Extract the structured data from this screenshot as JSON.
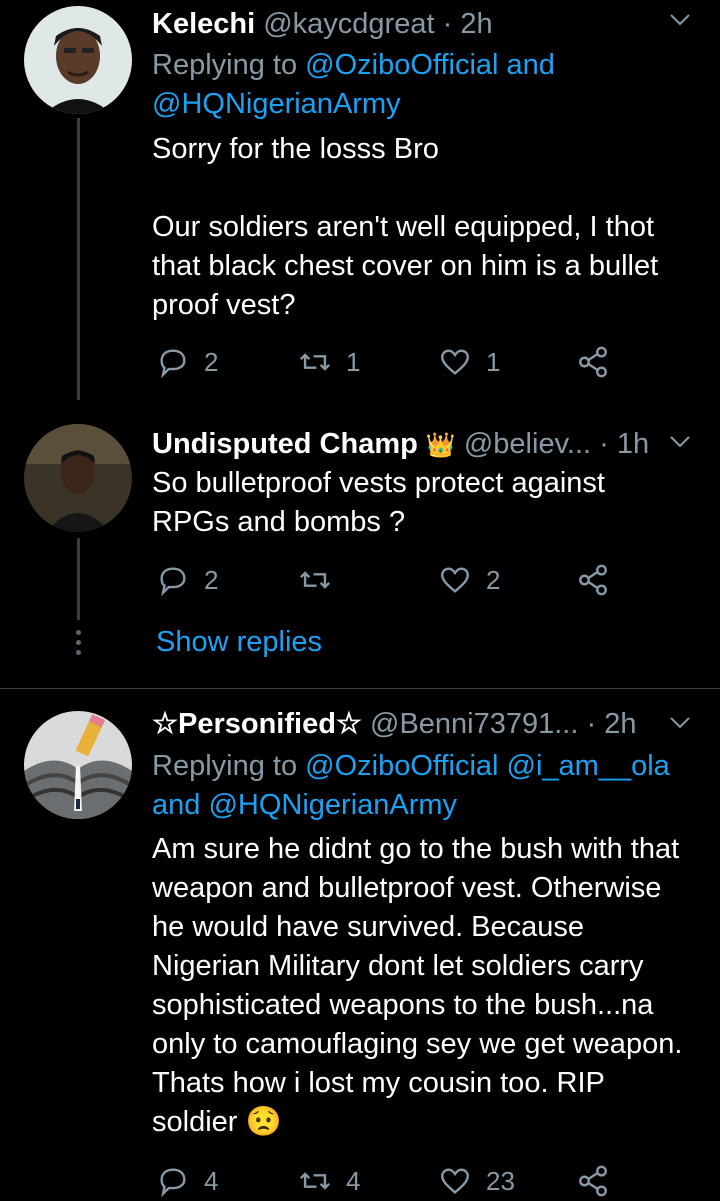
{
  "tweets": [
    {
      "name": "Kelechi",
      "handle": "@kaycdgreat",
      "time": "2h",
      "reply_prefix": "Replying to ",
      "reply_line1": "@OziboOfficial and",
      "reply_line2": "@HQNigerianArmy",
      "body": "Sorry for the losss Bro\n\nOur soldiers aren't well equipped, I thot that black chest cover on him is a bullet proof vest?",
      "replies": "2",
      "retweets": "1",
      "likes": "1"
    },
    {
      "name": "Undisputed Champ",
      "badge": "👑",
      "handle": "@believ...",
      "time": "1h",
      "body": "So bulletproof vests protect against RPGs and bombs ?",
      "replies": "2",
      "retweets": "",
      "likes": "2",
      "show_replies": "Show replies"
    },
    {
      "name": "☆Personified☆",
      "handle": "@Benni73791...",
      "time": "2h",
      "reply_prefix": "Replying to ",
      "reply_line1": "@OziboOfficial @i_am__ola",
      "reply_line2_prefix": "and ",
      "reply_line2": "@HQNigerianArmy",
      "body": "Am sure he didnt go to the bush with that weapon and bulletproof vest. Otherwise he would have survived. Because Nigerian Military dont let soldiers carry sophisticated weapons to the bush...na only to camouflaging sey we get weapon. Thats how i lost my cousin too. RIP soldier 😟",
      "replies": "4",
      "retweets": "4",
      "likes": "23"
    }
  ],
  "colors": {
    "background": "#000000",
    "secondary_text": "#8899a6",
    "link": "#1da1f2",
    "separator": "#38444d"
  },
  "icons": [
    "reply-icon",
    "retweet-icon",
    "like-icon",
    "share-icon",
    "chevron-down-icon",
    "crown-icon"
  ]
}
